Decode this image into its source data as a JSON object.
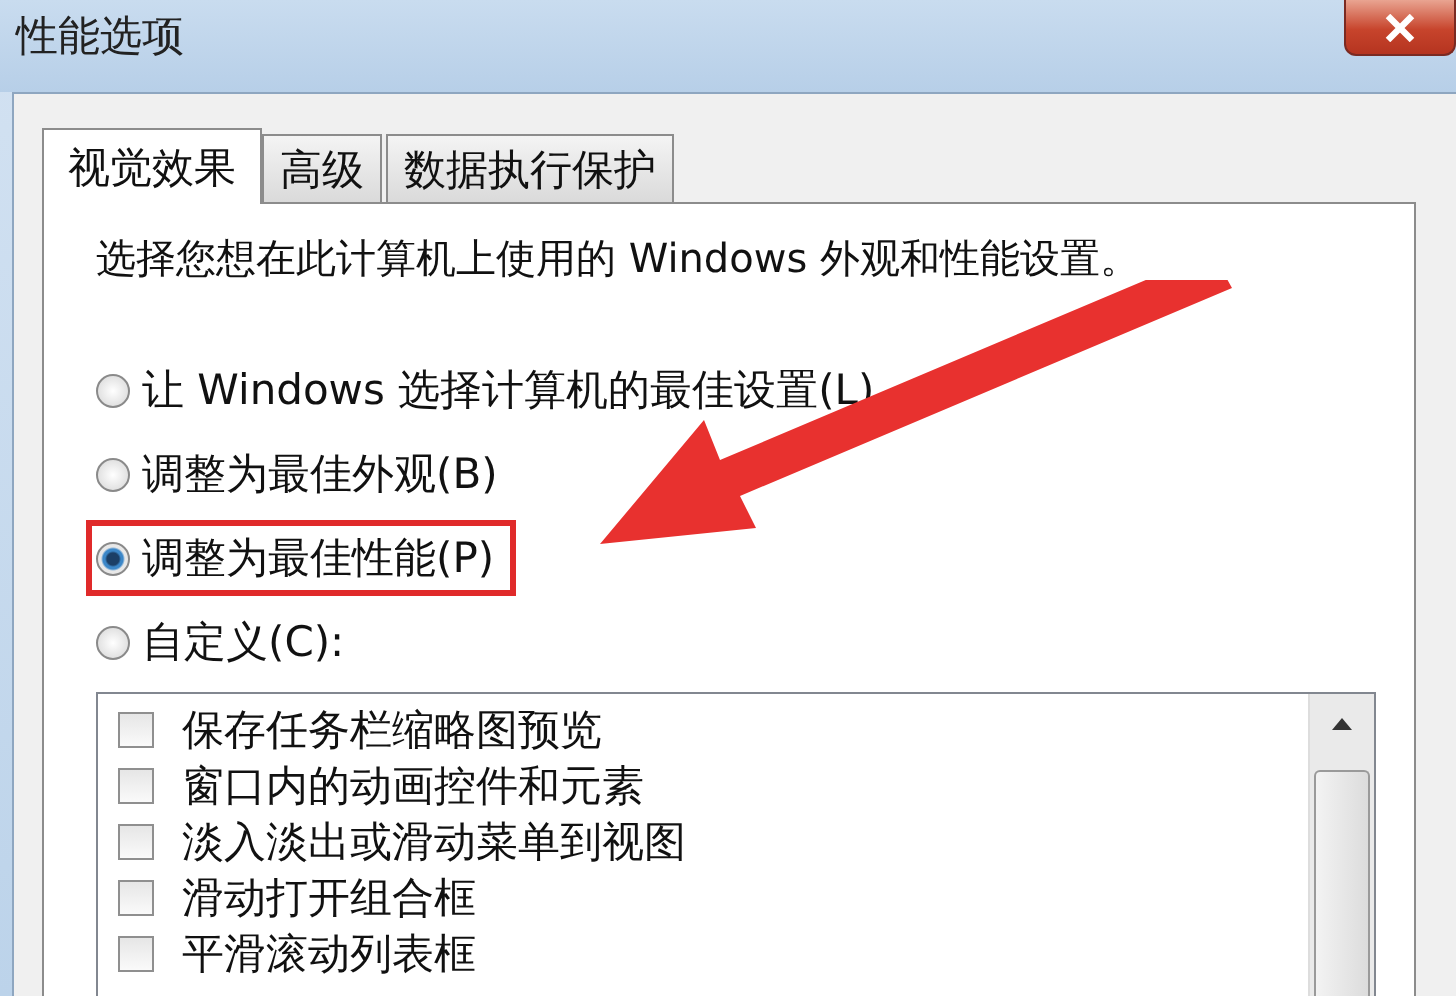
{
  "window": {
    "title": "性能选项"
  },
  "tabs": [
    {
      "label": "视觉效果",
      "selected": true
    },
    {
      "label": "高级",
      "selected": false
    },
    {
      "label": "数据执行保护",
      "selected": false
    }
  ],
  "description": "选择您想在此计算机上使用的 Windows 外观和性能设置。",
  "options": [
    {
      "label": "让 Windows 选择计算机的最佳设置(L)",
      "selected": false,
      "highlighted": false
    },
    {
      "label": "调整为最佳外观(B)",
      "selected": false,
      "highlighted": false
    },
    {
      "label": "调整为最佳性能(P)",
      "selected": true,
      "highlighted": true
    },
    {
      "label": "自定义(C):",
      "selected": false,
      "highlighted": false
    }
  ],
  "effects": [
    {
      "label": "保存任务栏缩略图预览",
      "checked": false
    },
    {
      "label": "窗口内的动画控件和元素",
      "checked": false
    },
    {
      "label": "淡入淡出或滑动菜单到视图",
      "checked": false
    },
    {
      "label": "滑动打开组合框",
      "checked": false
    },
    {
      "label": "平滑滚动列表框",
      "checked": false
    }
  ]
}
